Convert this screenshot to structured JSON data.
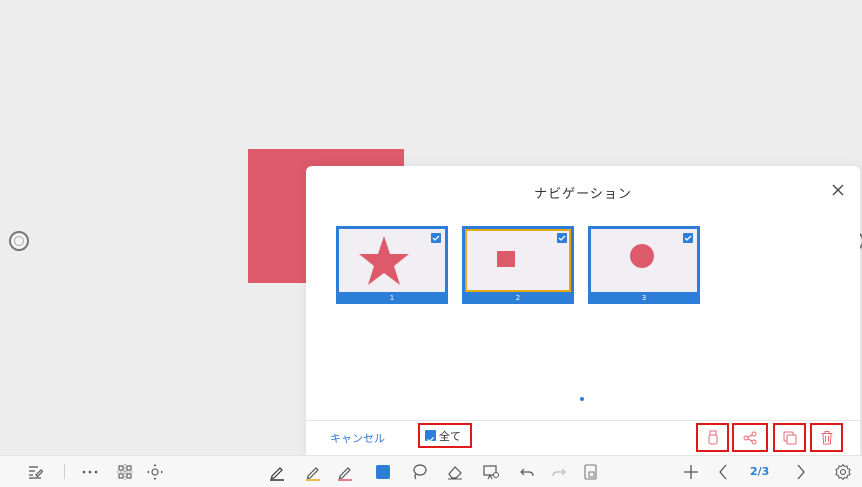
{
  "panel": {
    "title": "ナビゲーション",
    "cancel_label": "キャンセル",
    "select_all_label": "全て",
    "select_all_checked": true
  },
  "thumbnails": [
    {
      "number": "1",
      "shape": "star",
      "checked": true,
      "current": false
    },
    {
      "number": "2",
      "shape": "square",
      "checked": true,
      "current": true
    },
    {
      "number": "3",
      "shape": "circle",
      "checked": true,
      "current": false
    }
  ],
  "actions": [
    {
      "name": "save-to-usb-button",
      "icon": "usb-icon"
    },
    {
      "name": "share-button",
      "icon": "share-icon"
    },
    {
      "name": "duplicate-button",
      "icon": "copy-icon"
    },
    {
      "name": "delete-button",
      "icon": "trash-icon"
    }
  ],
  "toolbar": {
    "page_indicator": "2/3",
    "pen_colors": [
      "#333333",
      "#e6a817",
      "#d9566a"
    ],
    "fill_color": "#2d7ed8"
  },
  "colors": {
    "accent": "#2d7ed8",
    "shape_red": "#dd5a6a",
    "highlight_box": "#e01818",
    "current_page_border": "#e6a817"
  }
}
